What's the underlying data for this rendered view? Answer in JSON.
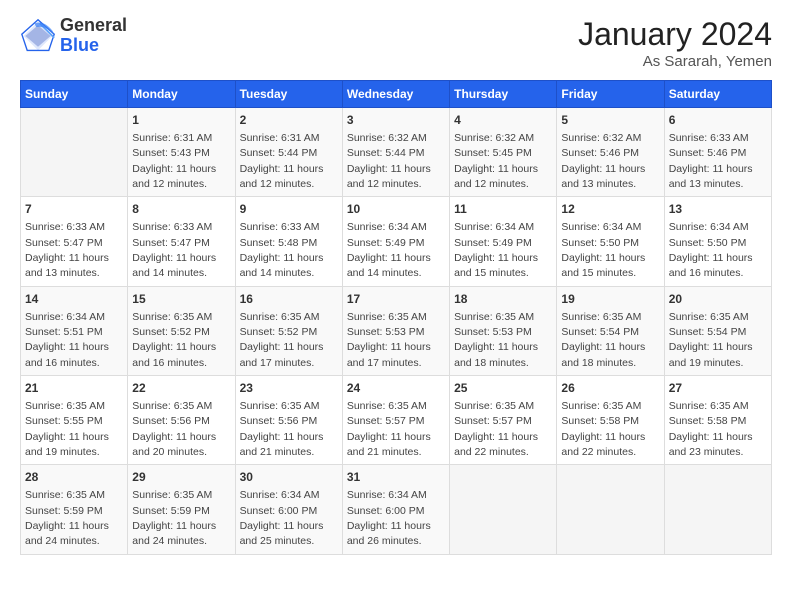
{
  "header": {
    "logo": {
      "general": "General",
      "blue": "Blue"
    },
    "title": "January 2024",
    "location": "As Sararah, Yemen"
  },
  "days_of_week": [
    "Sunday",
    "Monday",
    "Tuesday",
    "Wednesday",
    "Thursday",
    "Friday",
    "Saturday"
  ],
  "weeks": [
    [
      {
        "day": null,
        "info": null
      },
      {
        "day": "1",
        "info": "Sunrise: 6:31 AM\nSunset: 5:43 PM\nDaylight: 11 hours\nand 12 minutes."
      },
      {
        "day": "2",
        "info": "Sunrise: 6:31 AM\nSunset: 5:44 PM\nDaylight: 11 hours\nand 12 minutes."
      },
      {
        "day": "3",
        "info": "Sunrise: 6:32 AM\nSunset: 5:44 PM\nDaylight: 11 hours\nand 12 minutes."
      },
      {
        "day": "4",
        "info": "Sunrise: 6:32 AM\nSunset: 5:45 PM\nDaylight: 11 hours\nand 12 minutes."
      },
      {
        "day": "5",
        "info": "Sunrise: 6:32 AM\nSunset: 5:46 PM\nDaylight: 11 hours\nand 13 minutes."
      },
      {
        "day": "6",
        "info": "Sunrise: 6:33 AM\nSunset: 5:46 PM\nDaylight: 11 hours\nand 13 minutes."
      }
    ],
    [
      {
        "day": "7",
        "info": "Sunrise: 6:33 AM\nSunset: 5:47 PM\nDaylight: 11 hours\nand 13 minutes."
      },
      {
        "day": "8",
        "info": "Sunrise: 6:33 AM\nSunset: 5:47 PM\nDaylight: 11 hours\nand 14 minutes."
      },
      {
        "day": "9",
        "info": "Sunrise: 6:33 AM\nSunset: 5:48 PM\nDaylight: 11 hours\nand 14 minutes."
      },
      {
        "day": "10",
        "info": "Sunrise: 6:34 AM\nSunset: 5:49 PM\nDaylight: 11 hours\nand 14 minutes."
      },
      {
        "day": "11",
        "info": "Sunrise: 6:34 AM\nSunset: 5:49 PM\nDaylight: 11 hours\nand 15 minutes."
      },
      {
        "day": "12",
        "info": "Sunrise: 6:34 AM\nSunset: 5:50 PM\nDaylight: 11 hours\nand 15 minutes."
      },
      {
        "day": "13",
        "info": "Sunrise: 6:34 AM\nSunset: 5:50 PM\nDaylight: 11 hours\nand 16 minutes."
      }
    ],
    [
      {
        "day": "14",
        "info": "Sunrise: 6:34 AM\nSunset: 5:51 PM\nDaylight: 11 hours\nand 16 minutes."
      },
      {
        "day": "15",
        "info": "Sunrise: 6:35 AM\nSunset: 5:52 PM\nDaylight: 11 hours\nand 16 minutes."
      },
      {
        "day": "16",
        "info": "Sunrise: 6:35 AM\nSunset: 5:52 PM\nDaylight: 11 hours\nand 17 minutes."
      },
      {
        "day": "17",
        "info": "Sunrise: 6:35 AM\nSunset: 5:53 PM\nDaylight: 11 hours\nand 17 minutes."
      },
      {
        "day": "18",
        "info": "Sunrise: 6:35 AM\nSunset: 5:53 PM\nDaylight: 11 hours\nand 18 minutes."
      },
      {
        "day": "19",
        "info": "Sunrise: 6:35 AM\nSunset: 5:54 PM\nDaylight: 11 hours\nand 18 minutes."
      },
      {
        "day": "20",
        "info": "Sunrise: 6:35 AM\nSunset: 5:54 PM\nDaylight: 11 hours\nand 19 minutes."
      }
    ],
    [
      {
        "day": "21",
        "info": "Sunrise: 6:35 AM\nSunset: 5:55 PM\nDaylight: 11 hours\nand 19 minutes."
      },
      {
        "day": "22",
        "info": "Sunrise: 6:35 AM\nSunset: 5:56 PM\nDaylight: 11 hours\nand 20 minutes."
      },
      {
        "day": "23",
        "info": "Sunrise: 6:35 AM\nSunset: 5:56 PM\nDaylight: 11 hours\nand 21 minutes."
      },
      {
        "day": "24",
        "info": "Sunrise: 6:35 AM\nSunset: 5:57 PM\nDaylight: 11 hours\nand 21 minutes."
      },
      {
        "day": "25",
        "info": "Sunrise: 6:35 AM\nSunset: 5:57 PM\nDaylight: 11 hours\nand 22 minutes."
      },
      {
        "day": "26",
        "info": "Sunrise: 6:35 AM\nSunset: 5:58 PM\nDaylight: 11 hours\nand 22 minutes."
      },
      {
        "day": "27",
        "info": "Sunrise: 6:35 AM\nSunset: 5:58 PM\nDaylight: 11 hours\nand 23 minutes."
      }
    ],
    [
      {
        "day": "28",
        "info": "Sunrise: 6:35 AM\nSunset: 5:59 PM\nDaylight: 11 hours\nand 24 minutes."
      },
      {
        "day": "29",
        "info": "Sunrise: 6:35 AM\nSunset: 5:59 PM\nDaylight: 11 hours\nand 24 minutes."
      },
      {
        "day": "30",
        "info": "Sunrise: 6:34 AM\nSunset: 6:00 PM\nDaylight: 11 hours\nand 25 minutes."
      },
      {
        "day": "31",
        "info": "Sunrise: 6:34 AM\nSunset: 6:00 PM\nDaylight: 11 hours\nand 26 minutes."
      },
      {
        "day": null,
        "info": null
      },
      {
        "day": null,
        "info": null
      },
      {
        "day": null,
        "info": null
      }
    ]
  ]
}
